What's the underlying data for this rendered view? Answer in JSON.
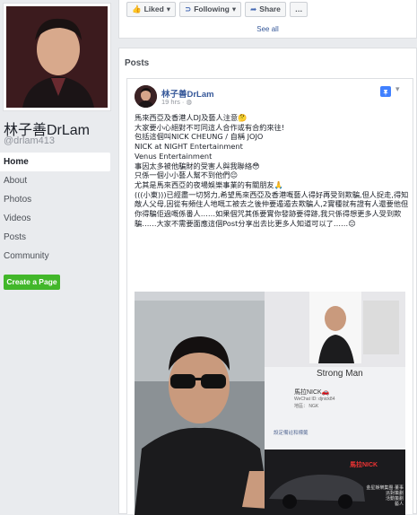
{
  "profile": {
    "name": "林子善DrLam",
    "handle": "@drlam413"
  },
  "nav": {
    "items": [
      "Home",
      "About",
      "Photos",
      "Videos",
      "Posts",
      "Community"
    ],
    "create_page": "Create a Page"
  },
  "actions": {
    "liked": "Liked",
    "following": "Following",
    "share": "Share",
    "more": "…",
    "see_all": "See all"
  },
  "posts": {
    "heading": "Posts",
    "author": "林子善DrLam",
    "meta": "19 hrs · ",
    "lines": [
      "馬來西亞及香港人DJ及藝人注意🤔",
      "大家要小心絕對不可同這人合作或有合約來往!",
      "包括這個叫NICK CHEUNG / 自稱 JOJO",
      "NICK at NIGHT Entertainment",
      "Venus Entertainment",
      "事因太多被他騙財的受害人與我聯絡😳",
      "只係一個小小藝人幫不到他們😔",
      "尤其是馬來西亞的夜場娛樂事業的有關朋友🙏",
      "(((小東)))已經盡一切努力,希望馬來西亞及香港嘅藝人得好再受到欺騙,但人捉走,得知敵人父母,因從有頻住人地嘅工被去之後仲要遁遁去欺騙人,2實種就有證有人還要他但你得騙佢過嘅係番人……如果個咒其係要實你發跡要得跡,我只係得想更多人受到欺騙……大家不需要面應這個Post分享出去比更多人知道可以了……😔"
    ],
    "photo": {
      "strong_man": "Strong Man",
      "nick1": "馬拉NICK🚗",
      "wechat_id": "WeChat ID: djnick84",
      "region": "地區：  NGK",
      "settings": "設定備註和標籤",
      "nick2": "馬拉NICK",
      "caption": "金星娛樂集團·董事\n派對策劃\n活動策劃\n藝人"
    }
  }
}
